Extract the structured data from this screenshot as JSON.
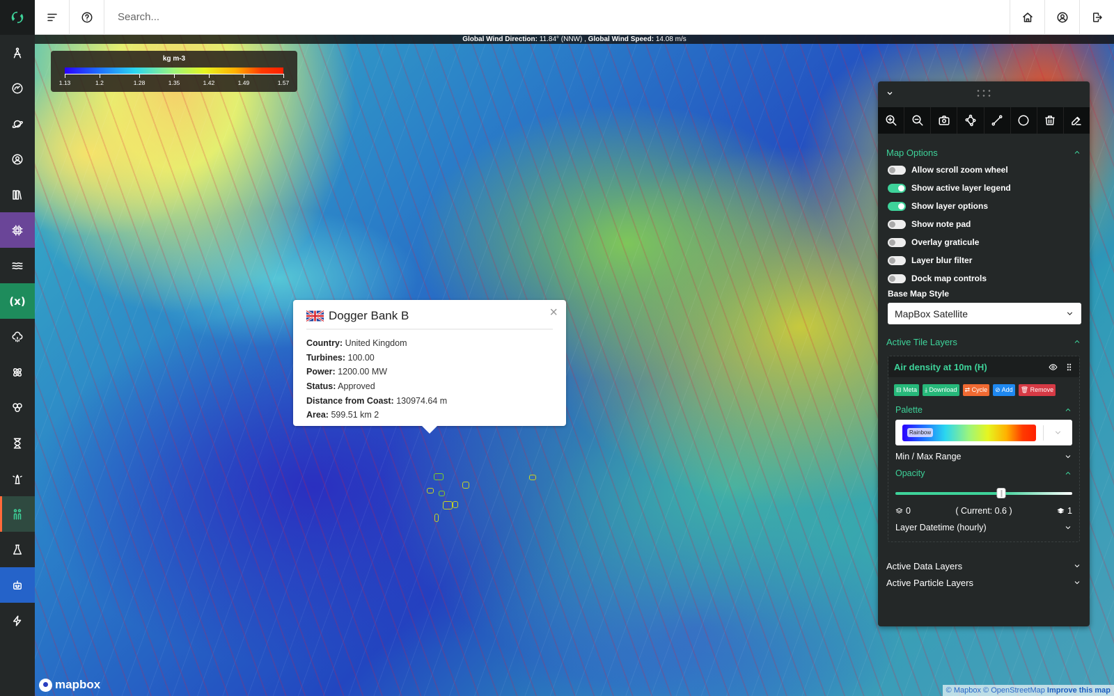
{
  "sidebar": {
    "items": [
      {
        "name": "compass-drafting",
        "style": ""
      },
      {
        "name": "gauge",
        "style": ""
      },
      {
        "name": "planet",
        "style": ""
      },
      {
        "name": "user-circle",
        "style": ""
      },
      {
        "name": "library",
        "style": ""
      },
      {
        "name": "cpu",
        "style": "purple"
      },
      {
        "name": "waves",
        "style": ""
      },
      {
        "name": "variable",
        "style": "green",
        "text": "(x)"
      },
      {
        "name": "cloud-rain",
        "style": ""
      },
      {
        "name": "atom",
        "style": ""
      },
      {
        "name": "circles",
        "style": ""
      },
      {
        "name": "hourglass",
        "style": ""
      },
      {
        "name": "lighthouse",
        "style": ""
      },
      {
        "name": "people",
        "style": "active"
      },
      {
        "name": "flask",
        "style": ""
      },
      {
        "name": "robot",
        "style": "blue"
      },
      {
        "name": "bolt",
        "style": ""
      }
    ]
  },
  "topbar": {
    "search_placeholder": "Search..."
  },
  "map": {
    "wind_direction_label": "Global Wind Direction:",
    "wind_direction_value": "11.84° (NNW) ,",
    "wind_speed_label": "Global Wind Speed:",
    "wind_speed_value": "14.08 m/s",
    "legend": {
      "unit": "kg m-3",
      "ticks": [
        "1.13",
        "1.2",
        "1.28",
        "1.35",
        "1.42",
        "1.49",
        "1.57"
      ],
      "min": 1.13,
      "max": 1.57
    },
    "popup": {
      "title": "Dogger Bank B",
      "close": "×",
      "rows": [
        {
          "label": "Country:",
          "value": "United Kingdom"
        },
        {
          "label": "Turbines:",
          "value": "100.00"
        },
        {
          "label": "Power:",
          "value": "1200.00 MW"
        },
        {
          "label": "Status:",
          "value": "Approved"
        },
        {
          "label": "Distance from Coast:",
          "value": "130974.64 m"
        },
        {
          "label": "Area:",
          "value": "599.51 km 2"
        }
      ]
    },
    "logo": "mapbox",
    "attribution": {
      "mapbox": "© Mapbox",
      "osm": "© OpenStreetMap",
      "improve": "Improve this map"
    }
  },
  "panel": {
    "tools": [
      "zoom-in",
      "zoom-out",
      "camera",
      "polygon",
      "line",
      "circle",
      "trash",
      "edit"
    ],
    "map_options": {
      "title": "Map Options",
      "options": [
        {
          "label": "Allow scroll zoom wheel",
          "on": false
        },
        {
          "label": "Show active layer legend",
          "on": true
        },
        {
          "label": "Show layer options",
          "on": true
        },
        {
          "label": "Show note pad",
          "on": false
        },
        {
          "label": "Overlay graticule",
          "on": false
        },
        {
          "label": "Layer blur filter",
          "on": false
        },
        {
          "label": "Dock map controls",
          "on": false
        }
      ],
      "base_map_label": "Base Map Style",
      "base_map_value": "MapBox Satellite"
    },
    "active_tile_layers": {
      "title": "Active Tile Layers",
      "layer": {
        "name": "Air density at 10m (H)",
        "buttons": [
          {
            "label": "⊟ Meta",
            "color": "g"
          },
          {
            "label": "⤓ Download",
            "color": "g"
          },
          {
            "label": "⇄ Cycle",
            "color": "o"
          },
          {
            "label": "⊘ Add",
            "color": "b"
          },
          {
            "label": "🗑 Remove",
            "color": "r"
          }
        ],
        "palette_title": "Palette",
        "palette_value": "Rainbow",
        "minmax_title": "Min / Max Range",
        "opacity_title": "Opacity",
        "opacity_min": "0",
        "opacity_max": "1",
        "opacity_current_text": "( Current: 0.6 )",
        "opacity_value": 0.6,
        "datetime_title": "Layer Datetime (hourly)"
      }
    },
    "active_data_layers": "Active Data Layers",
    "active_particle_layers": "Active Particle Layers"
  }
}
